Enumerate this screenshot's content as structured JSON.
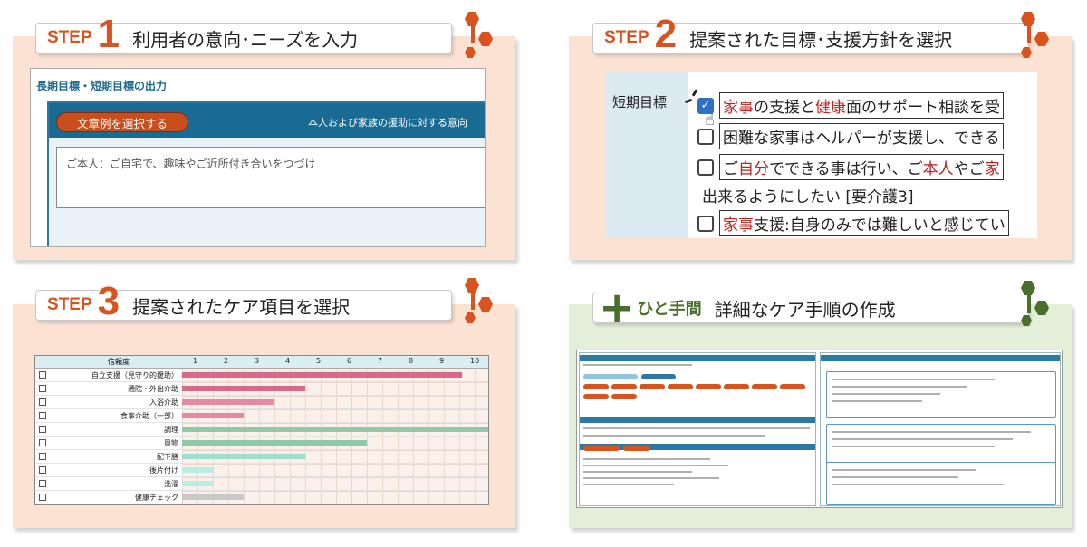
{
  "steps": [
    {
      "step": "STEP",
      "num": "1",
      "title": "利用者の意向･ニーズを入力"
    },
    {
      "step": "STEP",
      "num": "2",
      "title": "提案された目標･支援方針を選択"
    },
    {
      "step": "STEP",
      "num": "3",
      "title": "提案されたケア項目を選択"
    },
    {
      "step": "",
      "num": "",
      "title": "詳細なケア手順の作成",
      "prefix": "ひと手間",
      "plus": "+"
    }
  ],
  "colors": {
    "accent": "#d9531e",
    "green": "#4a6e2b",
    "panel": "#fbe2d3",
    "panel_green": "#e4efd9"
  },
  "p1": {
    "heading": "長期目標・短期目標の出力",
    "button": "文章例を選択する",
    "bar_text": "本人および家族の援助に対する意向",
    "input_value": "ご本人：ご自宅で、趣味やご近所付き合いをつづけ"
  },
  "p2": {
    "label": "短期目標",
    "rows": [
      {
        "checked": true,
        "segments": [
          {
            "t": "家事",
            "red": true
          },
          {
            "t": "の支援と"
          },
          {
            "t": "健康",
            "red": true
          },
          {
            "t": "面のサポート相談を受"
          }
        ]
      },
      {
        "checked": false,
        "segments": [
          {
            "t": "困難な家事はヘルパーが支援し、できる"
          }
        ]
      },
      {
        "checked": false,
        "segments": [
          {
            "t": "ご"
          },
          {
            "t": "自分",
            "red": true
          },
          {
            "t": "でできる事は行い、ご"
          },
          {
            "t": "本人",
            "red": true
          },
          {
            "t": "やご"
          },
          {
            "t": "家",
            "red": true
          }
        ]
      },
      {
        "checked": null,
        "segments": [
          {
            "t": "出来るようにしたい [要介護3]"
          }
        ]
      },
      {
        "checked": false,
        "segments": [
          {
            "t": "家事",
            "red": true
          },
          {
            "t": "支援:自身のみでは難しいと感じてい"
          }
        ]
      }
    ]
  },
  "p3": {
    "header": "信頼度",
    "ticks": [
      "1",
      "2",
      "3",
      "4",
      "5",
      "6",
      "7",
      "8",
      "9",
      "10"
    ],
    "chart_data": {
      "type": "bar",
      "categories": [
        "自立支援（見守り的援助）",
        "通院・外出介助",
        "入浴介助",
        "食事介助（一部）",
        "調理",
        "買物",
        "配下膳",
        "後片付け",
        "洗濯",
        "健康チェック"
      ],
      "values": [
        9.1,
        4.0,
        3.0,
        2.0,
        10.0,
        6.0,
        4.0,
        1.0,
        1.0,
        2.0
      ],
      "colors": [
        "#d56a8a",
        "#d56a8a",
        "#e58aa3",
        "#e58aa3",
        "#8fc9a8",
        "#8fc9a8",
        "#9fe0cc",
        "#b9eee4",
        "#b9eee4",
        "#c9c9c9"
      ],
      "xlim": [
        0,
        10
      ]
    }
  }
}
